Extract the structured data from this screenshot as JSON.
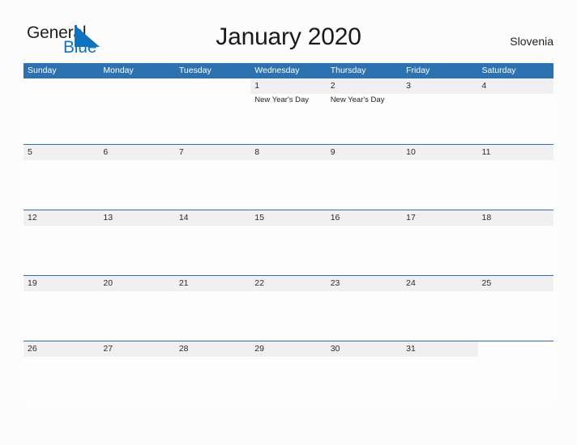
{
  "logo": {
    "word_one": "General",
    "word_two": "Blue",
    "triangle_color": "#1273bd",
    "text_color": "#231f20",
    "blue_text_color": "#1273bd"
  },
  "header": {
    "title": "January 2020",
    "region": "Slovenia"
  },
  "theme": {
    "header_blue": "#2c72b0",
    "band_gray": "#f0f0f0",
    "page_background": "#fcfcfc",
    "rule_blue": "#2c72b0"
  },
  "calendar": {
    "weekday_headers": [
      "Sunday",
      "Monday",
      "Tuesday",
      "Wednesday",
      "Thursday",
      "Friday",
      "Saturday"
    ],
    "weeks": [
      [
        {
          "date": "",
          "event": ""
        },
        {
          "date": "",
          "event": ""
        },
        {
          "date": "",
          "event": ""
        },
        {
          "date": "1",
          "event": "New Year's Day"
        },
        {
          "date": "2",
          "event": "New Year's Day"
        },
        {
          "date": "3",
          "event": ""
        },
        {
          "date": "4",
          "event": ""
        }
      ],
      [
        {
          "date": "5",
          "event": ""
        },
        {
          "date": "6",
          "event": ""
        },
        {
          "date": "7",
          "event": ""
        },
        {
          "date": "8",
          "event": ""
        },
        {
          "date": "9",
          "event": ""
        },
        {
          "date": "10",
          "event": ""
        },
        {
          "date": "11",
          "event": ""
        }
      ],
      [
        {
          "date": "12",
          "event": ""
        },
        {
          "date": "13",
          "event": ""
        },
        {
          "date": "14",
          "event": ""
        },
        {
          "date": "15",
          "event": ""
        },
        {
          "date": "16",
          "event": ""
        },
        {
          "date": "17",
          "event": ""
        },
        {
          "date": "18",
          "event": ""
        }
      ],
      [
        {
          "date": "19",
          "event": ""
        },
        {
          "date": "20",
          "event": ""
        },
        {
          "date": "21",
          "event": ""
        },
        {
          "date": "22",
          "event": ""
        },
        {
          "date": "23",
          "event": ""
        },
        {
          "date": "24",
          "event": ""
        },
        {
          "date": "25",
          "event": ""
        }
      ],
      [
        {
          "date": "26",
          "event": ""
        },
        {
          "date": "27",
          "event": ""
        },
        {
          "date": "28",
          "event": ""
        },
        {
          "date": "29",
          "event": ""
        },
        {
          "date": "30",
          "event": ""
        },
        {
          "date": "31",
          "event": ""
        },
        {
          "date": "",
          "event": ""
        }
      ]
    ]
  }
}
